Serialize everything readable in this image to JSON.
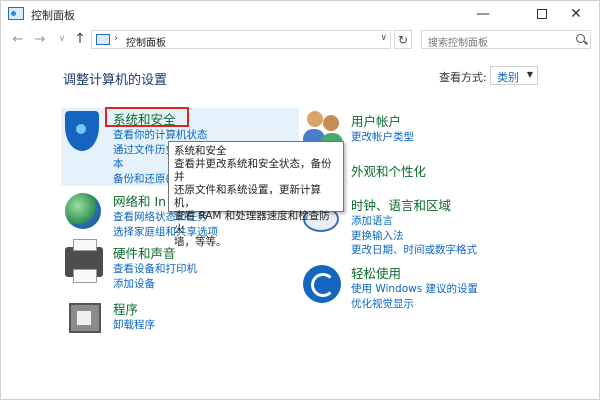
{
  "window": {
    "title": "控制面板",
    "minimize_glyph": "—",
    "close_glyph": "✕"
  },
  "nav": {
    "back_glyph": "←",
    "forward_glyph": "→",
    "recent_glyph": "∨",
    "up_glyph": "↑",
    "separator": "›",
    "breadcrumb": "控制面板",
    "dropdown_glyph": "∨",
    "refresh_glyph": "↻",
    "search_placeholder": "搜索控制面板"
  },
  "page": {
    "heading": "调整计算机的设置",
    "view_by_label": "查看方式:",
    "view_by_value": "类别",
    "view_caret": "▼"
  },
  "categories_left": [
    {
      "title": "系统和安全",
      "icon": "shield-icon",
      "links": [
        "查看你的计算机状态",
        "通过文件历史",
        "本",
        "备份和还原(W"
      ]
    },
    {
      "title": "网络和 In",
      "icon": "globe-icon",
      "links": [
        "查看网络状态和任务",
        "选择家庭组和共享选项"
      ]
    },
    {
      "title": "硬件和声音",
      "icon": "printer-icon",
      "links": [
        "查看设备和打印机",
        "添加设备"
      ]
    },
    {
      "title": "程序",
      "icon": "programs-icon",
      "links": [
        "卸载程序"
      ]
    }
  ],
  "categories_right": [
    {
      "title": "用户帐户",
      "icon": "users-icon",
      "links": [
        "更改帐户类型"
      ]
    },
    {
      "title": "外观和个性化",
      "icon": "",
      "links": []
    },
    {
      "title": "时钟、语言和区域",
      "icon": "clock-icon",
      "links": [
        "添加语言",
        "更换输入法",
        "更改日期、时间或数字格式"
      ]
    },
    {
      "title": "轻松使用",
      "icon": "ease-of-access-icon",
      "links": [
        "使用 Windows 建议的设置",
        "优化视觉显示"
      ]
    }
  ],
  "tooltip": {
    "title": "系统和安全",
    "lines": [
      "查看并更改系统和安全状态，备份并",
      "还原文件和系统设置，更新计算机，",
      "查看 RAM 和处理器速度和检查防火",
      "墙，等等。"
    ]
  },
  "colors": {
    "category_title": "#0b6a2d",
    "link": "#0b66c2",
    "highlight_bg": "#e6f2fb",
    "selection_border": "#e0261b"
  }
}
